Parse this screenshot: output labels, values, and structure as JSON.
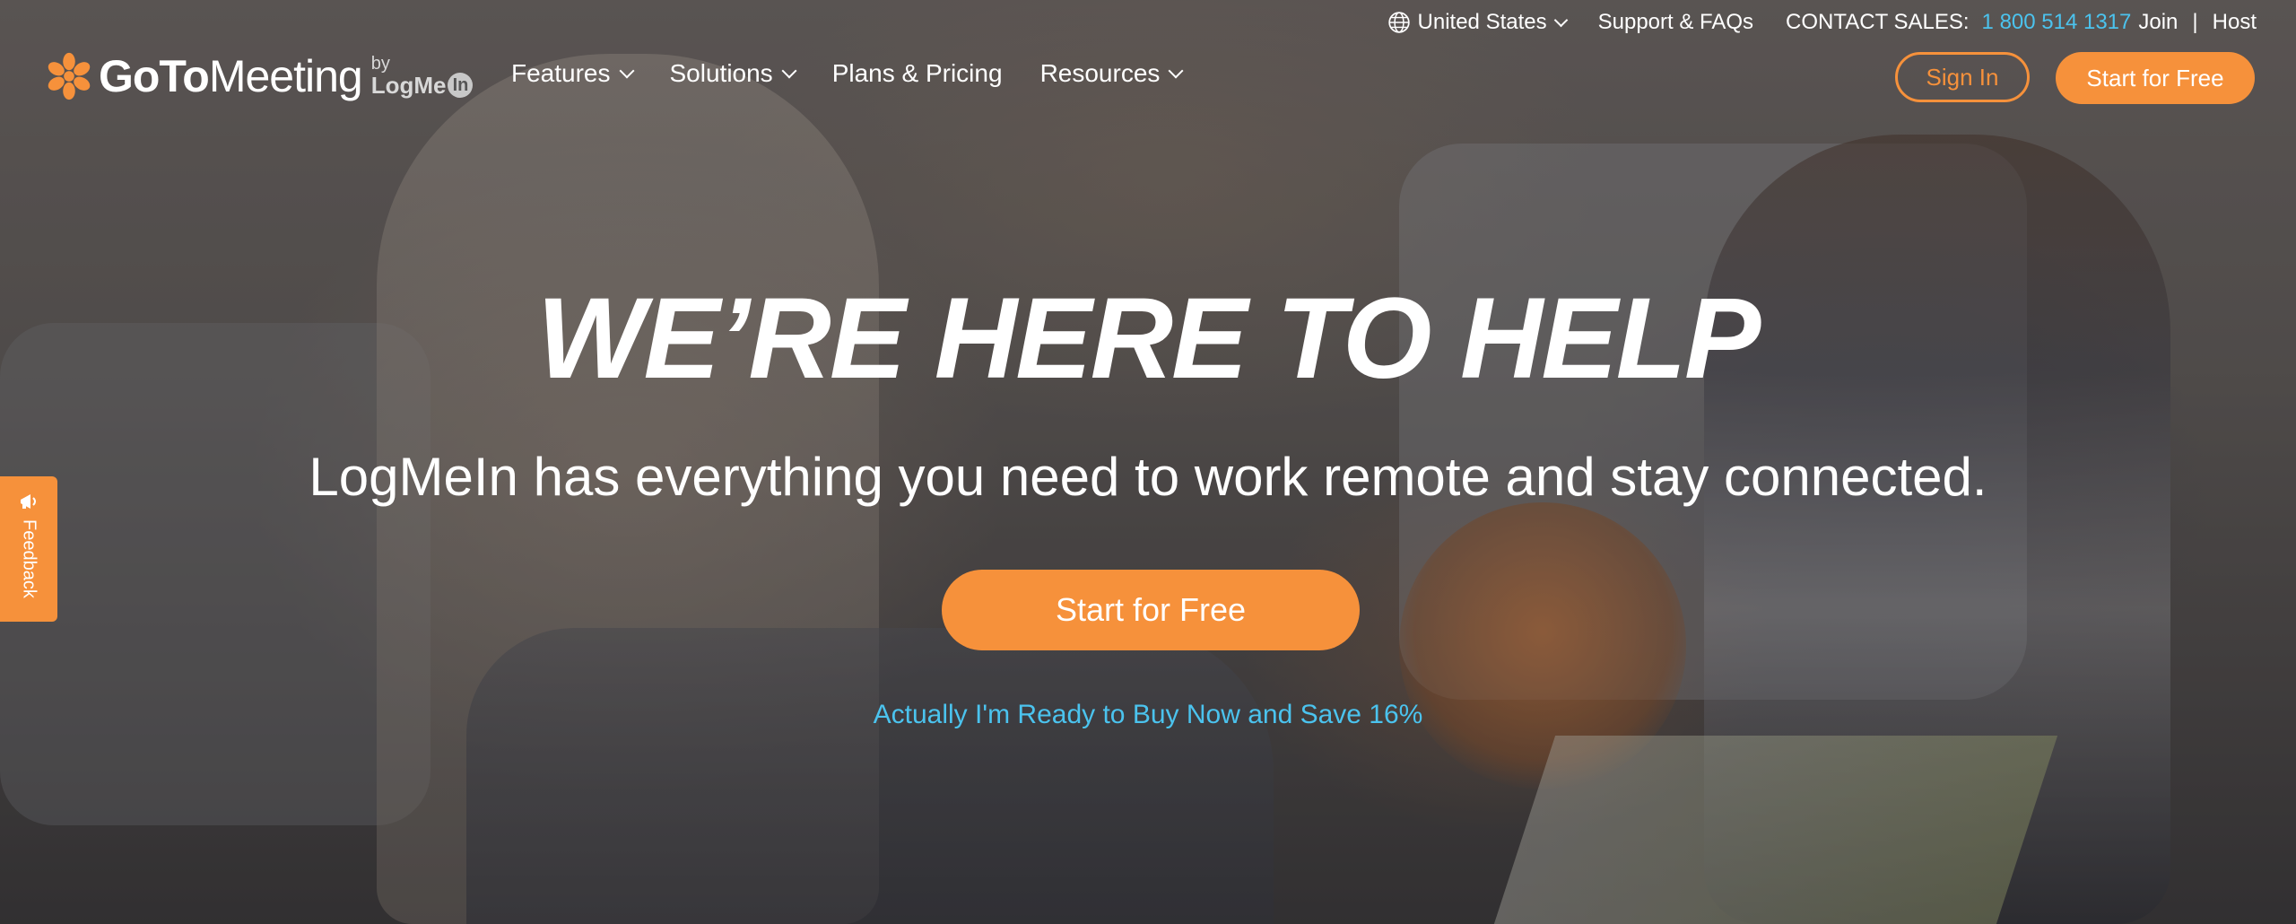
{
  "brand": {
    "name_bold": "GoTo",
    "name_light": "Meeting",
    "by_text": "by",
    "parent_text": "LogMe",
    "parent_badge": "In",
    "accent_color": "#f6913b",
    "link_color": "#4bc3ee"
  },
  "utility": {
    "region_label": "United States",
    "support_label": "Support & FAQs",
    "contact_label": "CONTACT SALES:",
    "phone": "1 800 514 1317",
    "join_label": "Join",
    "separator": "|",
    "host_label": "Host"
  },
  "nav": {
    "items": [
      {
        "label": "Features"
      },
      {
        "label": "Solutions"
      },
      {
        "label": "Plans & Pricing"
      },
      {
        "label": "Resources"
      }
    ]
  },
  "header_buttons": {
    "sign_in": "Sign In",
    "start_free": "Start for Free"
  },
  "hero": {
    "headline": "WE’RE HERE TO HELP",
    "subhead": "LogMeIn has everything you need to work remote and stay connected.",
    "cta": "Start for Free",
    "buy_link": "Actually I'm Ready to Buy Now and Save 16%"
  },
  "feedback": {
    "label": "Feedback"
  }
}
